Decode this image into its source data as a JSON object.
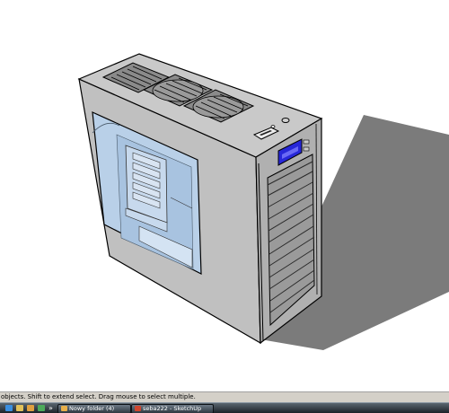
{
  "status_bar": {
    "hint": "objects. Shift to extend select. Drag mouse to select multiple."
  },
  "taskbar": {
    "quick_launch": [
      "ie-icon",
      "mail-icon",
      "folder-icon",
      "media-icon"
    ],
    "overflow_label": "»",
    "buttons": [
      {
        "label": "Nowy folder (4)",
        "icon": "folder-icon",
        "active": false
      },
      {
        "label": "seba222 - SketchUp",
        "icon": "sketchup-icon",
        "active": false
      }
    ]
  },
  "colors": {
    "case_body": "#c0c0c0",
    "case_front": "#b3b3b3",
    "case_top": "#c8c8c8",
    "window_glass": "#b6cde6",
    "lcd": "#2727d8",
    "shadow": "#7b7b7b",
    "grille": "#3a3a3a"
  }
}
